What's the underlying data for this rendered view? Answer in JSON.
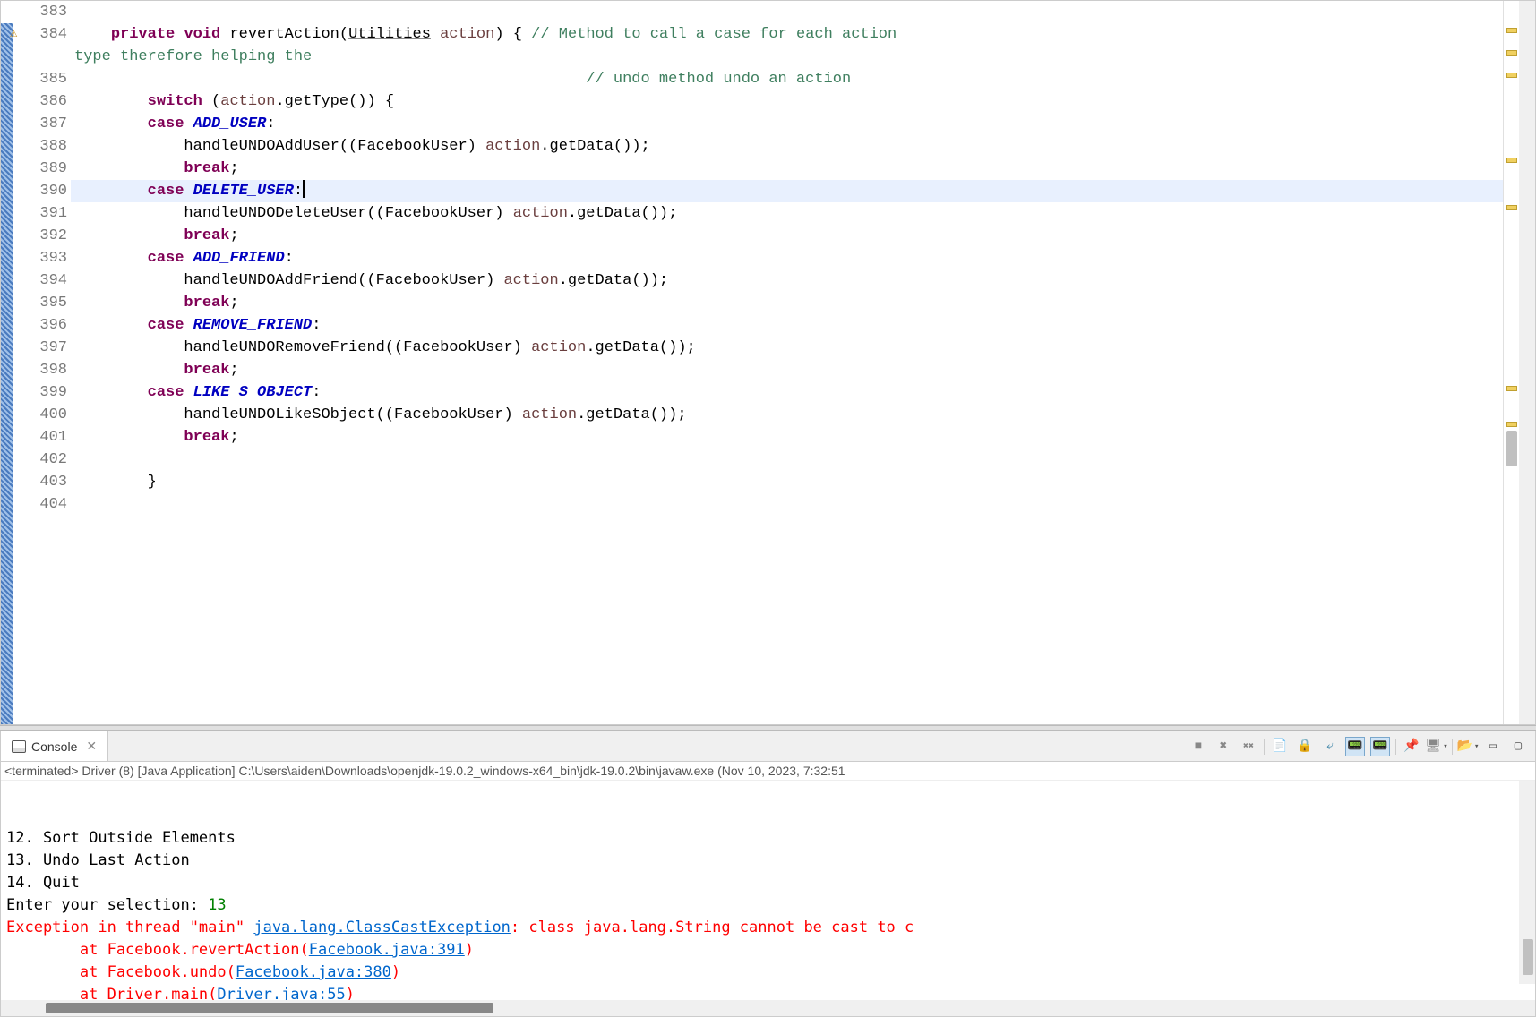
{
  "editor": {
    "lines": [
      {
        "num": "383",
        "html": ""
      },
      {
        "num": "384",
        "html": "    <span class='kw'>private</span> <span class='kw'>void</span> revertAction(<span class='type-underline'>Utilities</span> <span class='obj'>action</span>) { <span class='comment'>// Method to call a case for each action</span>",
        "warn": true,
        "fold": true,
        "wrap_prefix": "<span class='comment'>type therefore helping the</span>"
      },
      {
        "num": "385",
        "html": "                                                        <span class='comment'>// undo method undo an action</span>"
      },
      {
        "num": "386",
        "html": "        <span class='kw'>switch</span> (<span class='obj'>action</span>.getType()) {"
      },
      {
        "num": "387",
        "html": "        <span class='kw'>case</span> <span class='const-it'>ADD_USER</span>:"
      },
      {
        "num": "388",
        "html": "            handleUNDOAddUser((FacebookUser) <span class='obj'>action</span>.getData());"
      },
      {
        "num": "389",
        "html": "            <span class='kw'>break</span>;"
      },
      {
        "num": "390",
        "html": "        <span class='kw'>case</span> <span class='const-it'>DELETE_USER</span>:<span class='cursor'></span>",
        "highlight": true
      },
      {
        "num": "391",
        "html": "            handleUNDODeleteUser((FacebookUser) <span class='obj'>action</span>.getData());"
      },
      {
        "num": "392",
        "html": "            <span class='kw'>break</span>;"
      },
      {
        "num": "393",
        "html": "        <span class='kw'>case</span> <span class='const-it'>ADD_FRIEND</span>:"
      },
      {
        "num": "394",
        "html": "            handleUNDOAddFriend((FacebookUser) <span class='obj'>action</span>.getData());"
      },
      {
        "num": "395",
        "html": "            <span class='kw'>break</span>;"
      },
      {
        "num": "396",
        "html": "        <span class='kw'>case</span> <span class='const-it'>REMOVE_FRIEND</span>:"
      },
      {
        "num": "397",
        "html": "            handleUNDORemoveFriend((FacebookUser) <span class='obj'>action</span>.getData());"
      },
      {
        "num": "398",
        "html": "            <span class='kw'>break</span>;"
      },
      {
        "num": "399",
        "html": "        <span class='kw'>case</span> <span class='const-it'>LIKE_S_OBJECT</span>:"
      },
      {
        "num": "400",
        "html": "            handleUNDOLikeSObject((FacebookUser) <span class='obj'>action</span>.getData());"
      },
      {
        "num": "401",
        "html": "            <span class='kw'>break</span>;"
      },
      {
        "num": "402",
        "html": ""
      },
      {
        "num": "403",
        "html": "        }"
      },
      {
        "num": "404",
        "html": ""
      }
    ],
    "markers": [
      30,
      55,
      80,
      175,
      228,
      430,
      470
    ]
  },
  "console": {
    "tab_label": "Console",
    "header": "<terminated> Driver (8) [Java Application] C:\\Users\\aiden\\Downloads\\openjdk-19.0.2_windows-x64_bin\\jdk-19.0.2\\bin\\javaw.exe  (Nov 10, 2023, 7:32:51",
    "output": [
      {
        "text": "12. Sort Outside Elements"
      },
      {
        "text": "13. Undo Last Action"
      },
      {
        "text": "14. Quit"
      },
      {
        "html": "Enter your selection: <span class='green'>13</span>"
      },
      {
        "html": "<span class='red'>Exception in thread \"main\" </span><span class='red link'>java.lang.ClassCastException</span><span class='red'>: class java.lang.String cannot be cast to c</span>"
      },
      {
        "html": "<span class='red'>        at Facebook.revertAction(</span><span class='link'>Facebook.java:391</span><span class='red'>)</span>"
      },
      {
        "html": "<span class='red'>        at Facebook.undo(</span><span class='link'>Facebook.java:380</span><span class='red'>)</span>"
      },
      {
        "html": "<span class='red'>        at Driver.main(</span><span class='link'>Driver.java:55</span><span class='red'>)</span>"
      }
    ],
    "toolbar_icons": [
      {
        "name": "terminate",
        "glyph": "■",
        "color": "#888"
      },
      {
        "name": "remove-launch",
        "glyph": "✖",
        "color": "#888"
      },
      {
        "name": "remove-all",
        "glyph": "✖✖",
        "color": "#888",
        "size": "10px"
      },
      {
        "name": "sep"
      },
      {
        "name": "clear-console",
        "glyph": "📄",
        "color": "#6a6"
      },
      {
        "name": "scroll-lock",
        "glyph": "🔒",
        "color": "#c80"
      },
      {
        "name": "word-wrap",
        "glyph": "⤶",
        "color": "#48a"
      },
      {
        "name": "show-console-on-out",
        "glyph": "📟",
        "color": "#48a",
        "active": true
      },
      {
        "name": "show-console-on-err",
        "glyph": "📟",
        "color": "#c44",
        "active": true
      },
      {
        "name": "sep"
      },
      {
        "name": "pin-console",
        "glyph": "📌",
        "color": "#888"
      },
      {
        "name": "display-selected",
        "glyph": "🖥",
        "color": "#888",
        "dropdown": true
      },
      {
        "name": "sep"
      },
      {
        "name": "open-console",
        "glyph": "📂",
        "color": "#c80",
        "dropdown": true
      },
      {
        "name": "minimize",
        "glyph": "▭",
        "color": "#555"
      },
      {
        "name": "maximize",
        "glyph": "▢",
        "color": "#555"
      }
    ]
  }
}
